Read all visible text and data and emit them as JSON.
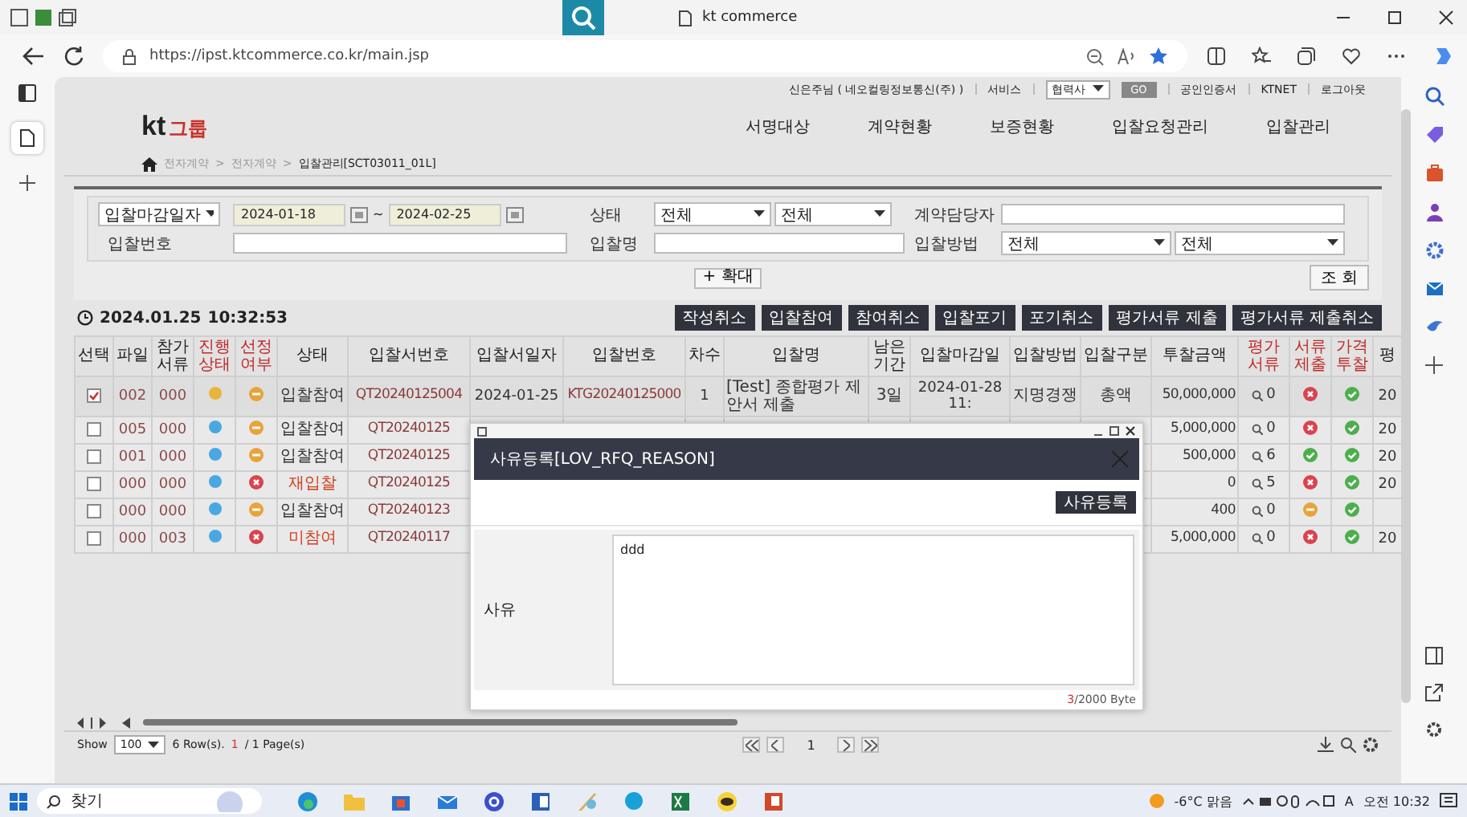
{
  "browser": {
    "tab_title": "kt commerce",
    "url": "https://ipst.ktcommerce.co.kr/main.jsp"
  },
  "util_bar": {
    "user": "신은주님 ( 네오컬링정보통신(주) )",
    "service": "서비스",
    "role": "협력사",
    "go": "GO",
    "links": [
      "공인인증서",
      "KTNET",
      "로그아웃"
    ]
  },
  "logo": {
    "mark": "kt",
    "text": "그룹"
  },
  "nav": [
    "서명대상",
    "계약현황",
    "보증현황",
    "입찰요청관리",
    "입찰관리"
  ],
  "breadcrumb": {
    "separator": ">",
    "items": [
      "전자계약",
      "전자계약",
      "입찰관리[SCT03011_01L]"
    ]
  },
  "search": {
    "date_type": "입찰마감일자",
    "date_from": "2024-01-18",
    "date_sep": "~",
    "date_to": "2024-02-25",
    "status_label": "상태",
    "status_1": "전체",
    "status_2": "전체",
    "manager_label": "계약담당자",
    "bid_no_label": "입찰번호",
    "bid_name_label": "입찰명",
    "method_label": "입찰방법",
    "method_1": "전체",
    "method_2": "전체",
    "expand": "+ 확대",
    "query": "조 회"
  },
  "clock": {
    "date": "2024.01.25",
    "time": "10:32:53"
  },
  "actions": [
    "작성취소",
    "입찰참여",
    "참여취소",
    "입찰포기",
    "포기취소",
    "평가서류 제출",
    "평가서류 제출취소"
  ],
  "table": {
    "columns": [
      {
        "label": "선택",
        "required": false
      },
      {
        "label": "파일",
        "required": false
      },
      {
        "label": "참가서류",
        "required": false
      },
      {
        "label": "진행상태",
        "required": true
      },
      {
        "label": "선정여부",
        "required": true
      },
      {
        "label": "상태",
        "required": false
      },
      {
        "label": "입찰서번호",
        "required": false
      },
      {
        "label": "입찰서일자",
        "required": false
      },
      {
        "label": "입찰번호",
        "required": false
      },
      {
        "label": "차수",
        "required": false
      },
      {
        "label": "입찰명",
        "required": false
      },
      {
        "label": "남은기간",
        "required": false
      },
      {
        "label": "입찰마감일",
        "required": false
      },
      {
        "label": "입찰방법",
        "required": false
      },
      {
        "label": "입찰구분",
        "required": false
      },
      {
        "label": "투찰금액",
        "required": false
      },
      {
        "label": "평가서류",
        "required": true
      },
      {
        "label": "서류제출",
        "required": true
      },
      {
        "label": "가격투찰",
        "required": true
      },
      {
        "label": "평",
        "required": false
      }
    ],
    "rows": [
      {
        "checked": true,
        "file": "002",
        "docs": "000",
        "color": "#e8b53a",
        "selection": {
          "kind": "hold"
        },
        "status": "입찰참여",
        "status_alert": false,
        "quote_no": "QT20240125004",
        "quote_date": "2024-01-25",
        "bid_no": "KTG20240125000",
        "round": "1",
        "bid_name": "[Test] 종합평가 제안서 제출",
        "remaining": "3일",
        "deadline": "2024-01-28 11:",
        "method": "지명경쟁",
        "bid_type": "총액",
        "amount": "50,000,000",
        "eval_docs": "0",
        "doc_submit": {
          "kind": "rejected"
        },
        "price_bid": {
          "kind": "approved"
        },
        "last": "20"
      },
      {
        "checked": false,
        "file": "005",
        "docs": "000",
        "color": "#4aa8e0",
        "selection": {
          "kind": "hold"
        },
        "status": "입찰참여",
        "status_alert": false,
        "quote_no": "QT20240125",
        "amount": "5,000,000",
        "eval_docs": "0",
        "doc_submit": {
          "kind": "rejected"
        },
        "price_bid": {
          "kind": "approved"
        },
        "last": "20"
      },
      {
        "checked": false,
        "file": "001",
        "docs": "000",
        "color": "#4aa8e0",
        "selection": {
          "kind": "hold"
        },
        "status": "입찰참여",
        "status_alert": false,
        "quote_no": "QT20240125",
        "amount": "500,000",
        "eval_docs": "6",
        "doc_submit": {
          "kind": "approved"
        },
        "price_bid": {
          "kind": "approved"
        },
        "last": "20"
      },
      {
        "checked": false,
        "file": "000",
        "docs": "000",
        "color": "#4aa8e0",
        "selection": {
          "kind": "rejected"
        },
        "status": "재입찰",
        "status_alert": true,
        "quote_no": "QT20240125",
        "amount": "0",
        "eval_docs": "5",
        "doc_submit": {
          "kind": "rejected"
        },
        "price_bid": {
          "kind": "approved"
        },
        "last": "20"
      },
      {
        "checked": false,
        "file": "000",
        "docs": "000",
        "color": "#4aa8e0",
        "selection": {
          "kind": "hold"
        },
        "status": "입찰참여",
        "status_alert": false,
        "quote_no": "QT20240123",
        "amount": "400",
        "eval_docs": "0",
        "doc_submit": {
          "kind": "hold"
        },
        "price_bid": {
          "kind": "approved"
        }
      },
      {
        "checked": false,
        "file": "000",
        "docs": "003",
        "color": "#4aa8e0",
        "selection": {
          "kind": "rejected"
        },
        "status": "미참여",
        "status_alert": true,
        "quote_no": "QT20240117",
        "amount": "5,000,000",
        "eval_docs": "0",
        "doc_submit": {
          "kind": "rejected"
        },
        "price_bid": {
          "kind": "approved"
        },
        "last": "20"
      }
    ]
  },
  "footer": {
    "show": "Show",
    "page_size": "100",
    "rows": "6 Row(s).",
    "page_current": "1",
    "page_total": "/ 1 Page(s)",
    "page": "1"
  },
  "modal": {
    "title": "사유등록[LOV_RFQ_REASON]",
    "submit": "사유등록",
    "field_label": "사유",
    "value": "ddd",
    "byte_count": "3",
    "byte_limit": "/2000 Byte"
  },
  "taskbar": {
    "search": "찾기",
    "weather": "-6°C 맑음",
    "ime": "A",
    "time": "오전 10:32"
  }
}
